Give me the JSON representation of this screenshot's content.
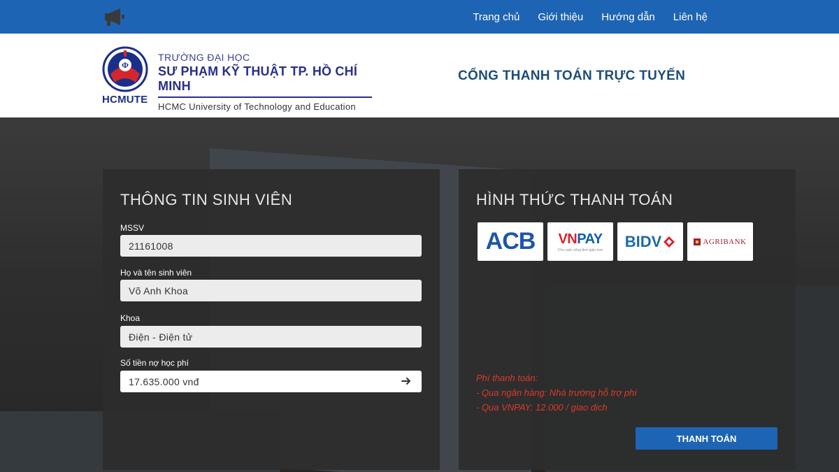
{
  "nav": {
    "items": [
      "Trang chủ",
      "Giới thiệu",
      "Hướng dẫn",
      "Liên hệ"
    ]
  },
  "header": {
    "abbr": "HCMUTE",
    "line1": "TRƯỜNG ĐẠI HỌC",
    "line2": "SƯ PHẠM KỸ THUẬT TP. HỒ CHÍ MINH",
    "line3": "HCMC University of Technology and Education",
    "portal_title": "CỔNG THANH TOÁN TRỰC TUYẾN"
  },
  "student": {
    "title": "THÔNG TIN SINH VIÊN",
    "fields": [
      {
        "label": "MSSV",
        "value": "21161008"
      },
      {
        "label": "Họ và tên sinh viên",
        "value": "Võ Anh Khoa"
      },
      {
        "label": "Khoa",
        "value": "Điện - Điện tử"
      },
      {
        "label": "Số tiền nợ học phí",
        "value": "17.635.000 vnđ"
      }
    ]
  },
  "payment": {
    "title": "HÌNH THỨC THANH TOÁN",
    "banks": [
      {
        "name": "ACB"
      },
      {
        "name_vn": "VN",
        "name_pay": "PAY",
        "tagline": "Cho cuộc sống đơn giản hơn"
      },
      {
        "name": "BIDV"
      },
      {
        "name": "AGRIBANK"
      }
    ],
    "fee_title": "Phí thanh toán:",
    "fee_lines": [
      "- Qua ngân hàng: Nhà trường hỗ trợ phí",
      "- Qua VNPAY: 12.000 / giao dịch"
    ],
    "button": "THANH TOÁN"
  },
  "colors": {
    "primary": "#1e64b4",
    "fee_text": "#d93a2b",
    "panel_bg": "#2d2d2d"
  },
  "icons": {
    "megaphone": "megaphone-icon",
    "arrow": "arrow-right-icon"
  }
}
